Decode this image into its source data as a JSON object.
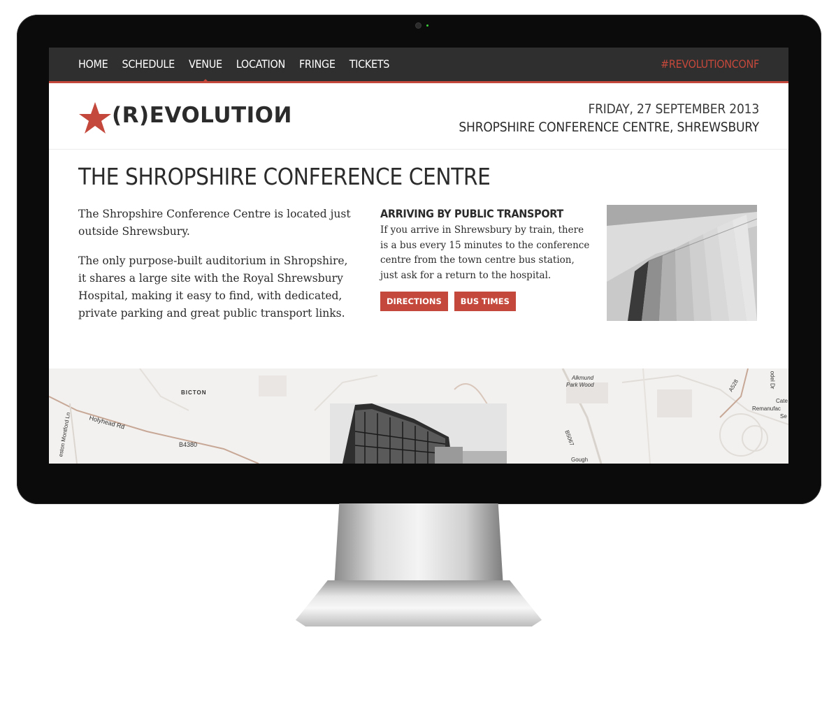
{
  "nav": {
    "items": [
      {
        "label": "HOME"
      },
      {
        "label": "SCHEDULE"
      },
      {
        "label": "VENUE"
      },
      {
        "label": "LOCATION"
      },
      {
        "label": "FRINGE"
      },
      {
        "label": "TICKETS"
      }
    ],
    "active_item": "VENUE",
    "hashtag": "#REVOLUTIONCONF"
  },
  "header": {
    "logo_text": "(R)EVOLUTIOИ",
    "date": "FRIDAY, 27 SEPTEMBER 2013",
    "venue": "SHROPSHIRE CONFERENCE CENTRE, SHREWSBURY"
  },
  "main": {
    "title": "THE SHROPSHIRE CONFERENCE CENTRE",
    "intro_paragraphs": [
      "The Shropshire Conference Centre is located just outside Shrewsbury.",
      "The only purpose-built auditorium in Shropshire, it shares a large site with the Royal Shrewsbury Hospital, making it easy to find, with dedicated, private parking and great public transport links."
    ],
    "transport": {
      "heading": "ARRIVING BY PUBLIC TRANSPORT",
      "text": "If you arrive in Shrewsbury by train, there is a bus every 15 minutes to the conference centre from the town centre bus station, just ask for a return to the hospital.",
      "directions_label": "DIRECTIONS",
      "bus_times_label": "BUS TIMES"
    }
  },
  "map": {
    "labels": {
      "bicton": "BICTON",
      "holyhead": "Holyhead Rd",
      "b4380": "B4380",
      "montford": "eston Montford Ln",
      "alkmund": "Alkmund",
      "park_wood": "Park Wood",
      "b5067": "B5067",
      "gough": "Gough",
      "a528": "A528",
      "cate": "Cate",
      "remanufac": "Remanufac",
      "se": "Se",
      "odel": "odel Dr"
    }
  },
  "colors": {
    "accent": "#c4483b",
    "nav_bg": "#2f2f2f",
    "text": "#2b2b2b"
  }
}
